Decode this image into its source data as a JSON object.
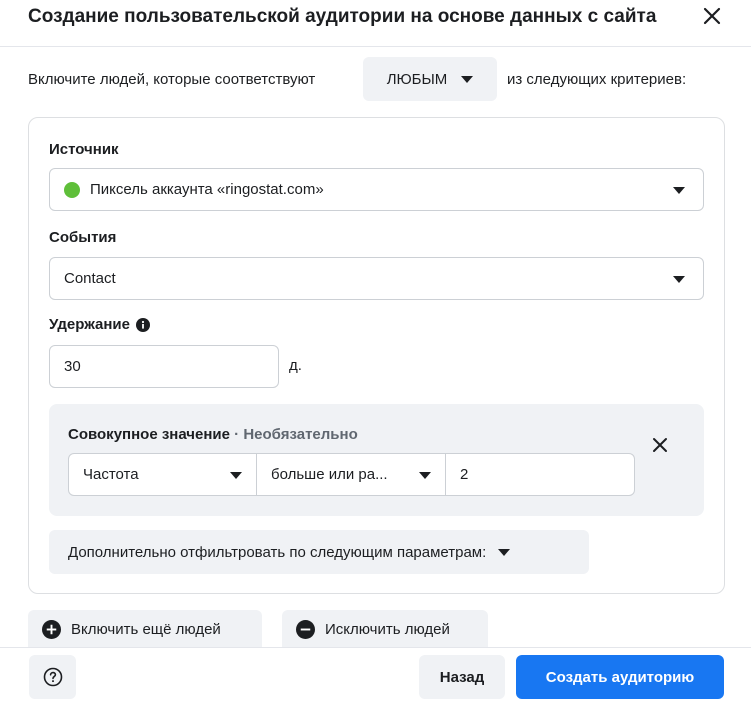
{
  "dialog": {
    "title": "Создание пользовательской аудитории на основе данных с сайта"
  },
  "include_rule": {
    "prefix": "Включите людей, которые соответствуют",
    "match_value": "ЛЮБЫМ",
    "suffix": "из следующих критериев:"
  },
  "source": {
    "label": "Источник",
    "value": "Пиксель аккаунта «ringostat.com»",
    "status_color": "#5fbf3a"
  },
  "events": {
    "label": "События",
    "value": "Contact"
  },
  "retention": {
    "label": "Удержание",
    "value": "30",
    "unit": "д."
  },
  "aggregate": {
    "title": "Совокупное значение",
    "optional": "· Необязательно",
    "metric": "Частота",
    "operator": "больше или ра...",
    "value": "2"
  },
  "refine": {
    "label": "Дополнительно отфильтровать по следующим параметрам:"
  },
  "actions": {
    "include_more": "Включить ещё людей",
    "exclude": "Исключить людей"
  },
  "footer": {
    "back": "Назад",
    "create": "Создать аудиторию"
  },
  "colors": {
    "primary": "#1877f2",
    "surface": "#f0f2f5",
    "border": "#ccd0d5"
  }
}
